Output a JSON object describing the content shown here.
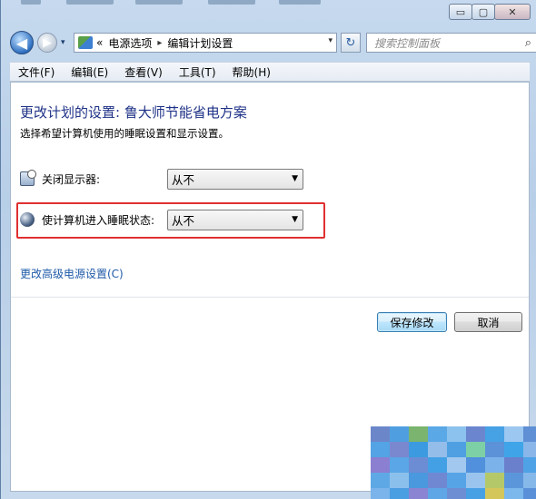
{
  "window": {
    "minimize_glyph": "▭",
    "maximize_glyph": "▢",
    "close_glyph": "✕"
  },
  "nav": {
    "back_glyph": "◀",
    "forward_glyph": "▶",
    "address_prefix": "«",
    "breadcrumb": [
      "电源选项",
      "编辑计划设置"
    ],
    "breadcrumb_sep": "▸",
    "dropdown_glyph": "▾",
    "refresh_glyph": "↻",
    "search_placeholder": "搜索控制面板",
    "search_glyph": "⌕"
  },
  "menu": [
    "文件(F)",
    "编辑(E)",
    "查看(V)",
    "工具(T)",
    "帮助(H)"
  ],
  "page": {
    "title": "更改计划的设置: 鲁大师节能省电方案",
    "subtitle": "选择希望计算机使用的睡眠设置和显示设置。",
    "display_off_label": "关闭显示器:",
    "display_off_value": "从不",
    "sleep_label": "使计算机进入睡眠状态:",
    "sleep_value": "从不",
    "select_arrow": "▼",
    "advanced_link": "更改高级电源设置(C)",
    "save_button": "保存修改",
    "cancel_button": "取消"
  },
  "colors": {
    "title": "#1e3287",
    "link": "#1e5aa8",
    "highlight": "#e03030"
  }
}
